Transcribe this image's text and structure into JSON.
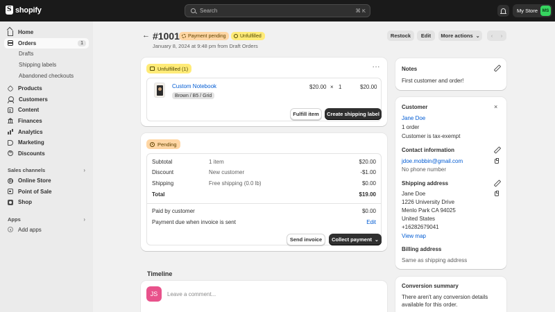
{
  "topbar": {
    "logo_text": "shopify",
    "search_placeholder": "Search",
    "search_shortcut": "⌘ K",
    "store_name": "My Store",
    "store_initials": "MS"
  },
  "sidebar": {
    "items": [
      {
        "label": "Home"
      },
      {
        "label": "Orders",
        "count": "1"
      },
      {
        "label": "Drafts"
      },
      {
        "label": "Shipping labels"
      },
      {
        "label": "Abandoned checkouts"
      },
      {
        "label": "Products"
      },
      {
        "label": "Customers"
      },
      {
        "label": "Content"
      },
      {
        "label": "Finances"
      },
      {
        "label": "Analytics"
      },
      {
        "label": "Marketing"
      },
      {
        "label": "Discounts"
      }
    ],
    "sales_channels_title": "Sales channels",
    "channels": [
      {
        "label": "Online Store"
      },
      {
        "label": "Point of Sale"
      },
      {
        "label": "Shop"
      }
    ],
    "apps_title": "Apps",
    "add_apps": "Add apps"
  },
  "header": {
    "back": "←",
    "order_number": "#1001",
    "badge_payment": "Payment pending",
    "badge_fulfillment": "Unfulfilled",
    "meta": "January 8, 2024 at 9:48 pm from Draft Orders",
    "restock": "Restock",
    "edit": "Edit",
    "more_actions": "More actions",
    "prev": "‹",
    "next": "›"
  },
  "fulfillment": {
    "status": "Unfulfilled (1)",
    "menu": "···",
    "product_name": "Custom Notebook",
    "variant": "Brown / B5 / Grid",
    "unit_price": "$20.00",
    "times": "×",
    "quantity": "1",
    "line_total": "$20.00",
    "fulfill_button": "Fulfill item",
    "shipping_label_button": "Create shipping label"
  },
  "payment": {
    "status": "Pending",
    "rows": [
      {
        "label": "Subtotal",
        "detail": "1 item",
        "amount": "$20.00"
      },
      {
        "label": "Discount",
        "detail": "New customer",
        "amount": "-$1.00"
      },
      {
        "label": "Shipping",
        "detail": "Free shipping (0.0 lb)",
        "amount": "$0.00"
      },
      {
        "label": "Total",
        "detail": "",
        "amount": "$19.00"
      }
    ],
    "paid_label": "Paid by customer",
    "paid_amount": "$0.00",
    "due_label": "Payment due when invoice is sent",
    "due_edit": "Edit",
    "send_invoice": "Send invoice",
    "collect_payment": "Collect payment"
  },
  "timeline": {
    "title": "Timeline",
    "avatar_initials": "JS",
    "comment_placeholder": "Leave a comment..."
  },
  "notes": {
    "title": "Notes",
    "text": "First customer and order!"
  },
  "customer": {
    "title": "Customer",
    "name": "Jane Doe",
    "orders": "1 order",
    "tax": "Customer is tax-exempt",
    "contact_title": "Contact information",
    "email": "jdoe.mobbin@gmail.com",
    "phone": "No phone number",
    "shipping_title": "Shipping address",
    "address_lines": [
      "Jane Doe",
      "1226 University Drive",
      "Menlo Park CA 94025",
      "United States",
      "+16282679041"
    ],
    "view_map": "View map",
    "billing_title": "Billing address",
    "billing_text": "Same as shipping address"
  },
  "conversion": {
    "title": "Conversion summary",
    "text_line1": "There aren't any conversion details",
    "text_line2": "available for this order."
  }
}
